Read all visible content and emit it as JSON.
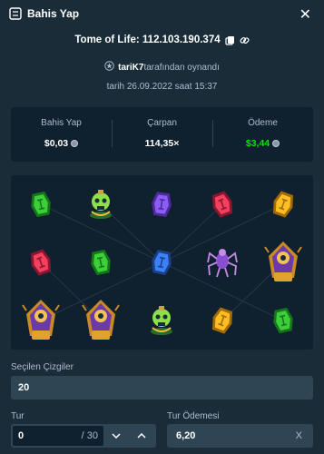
{
  "header": {
    "title": "Bahis Yap",
    "icon": "bet-slip-icon",
    "close_icon": "close-icon"
  },
  "game": {
    "title": "Tome of Life: 112.103.190.374",
    "icons": [
      "copy-icon",
      "link-icon"
    ]
  },
  "player": {
    "username": "tariK7",
    "suffix": "tarafından oynandı",
    "icon": "star-badge-icon"
  },
  "date": "tarih 26.09.2022 saat 15:37",
  "stats": {
    "bet_label": "Bahis Yap",
    "bet_value": "$0,03",
    "multiplier_label": "Çarpan",
    "multiplier_value": "114,35×",
    "payout_label": "Ödeme",
    "payout_value": "$3,44",
    "currency_icon": "coin-icon"
  },
  "board": {
    "rows": [
      [
        "green-rune-gem",
        "green-skull-potion",
        "purple-rune-gem",
        "red-rune-gem",
        "yellow-rune-gem"
      ],
      [
        "red-rune-gem",
        "green-rune-gem",
        "blue-rune-gem",
        "purple-spider",
        "tome-wizard"
      ],
      [
        "tome-wizard",
        "tome-wizard",
        "green-skull-potion",
        "yellow-rune-gem",
        "green-rune-gem"
      ]
    ]
  },
  "lines": {
    "label": "Seçilen Çizgiler",
    "value": "20"
  },
  "round": {
    "label": "Tur",
    "value": "0",
    "suffix": "/ 30"
  },
  "round_payout": {
    "label": "Tur Ödemesi",
    "value": "6,20",
    "suffix": "X"
  }
}
